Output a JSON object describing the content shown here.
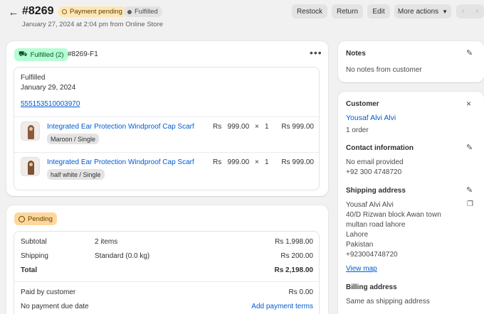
{
  "header": {
    "order_id": "#8269",
    "payment_status": "Payment pending",
    "fulfillment_status": "Fulfilled",
    "subtitle": "January 27, 2024 at 2:04 pm from Online Store",
    "buttons": {
      "restock": "Restock",
      "return": "Return",
      "edit": "Edit",
      "more": "More actions"
    }
  },
  "fulfillment": {
    "tag": "Fulfilled (2)",
    "number": "#8269-F1",
    "status_label": "Fulfilled",
    "date": "January 29, 2024",
    "tracking": "555153510003970",
    "items": [
      {
        "name": "Integrated Ear Protection Windproof Cap Scarf",
        "variant": "Maroon / Single",
        "price": "Rs   999.00",
        "times": "×",
        "qty": "1",
        "total": "Rs 999.00"
      },
      {
        "name": "Integrated Ear Protection Windproof Cap Scarf",
        "variant": "half white / Single",
        "price": "Rs   999.00",
        "times": "×",
        "qty": "1",
        "total": "Rs 999.00"
      }
    ]
  },
  "payment": {
    "tag": "Pending",
    "rows": {
      "subtotal": {
        "label": "Subtotal",
        "mid": "2 items",
        "value": "Rs 1,998.00"
      },
      "shipping": {
        "label": "Shipping",
        "mid": "Standard (0.0 kg)",
        "value": "Rs 200.00"
      },
      "total": {
        "label": "Total",
        "value": "Rs 2,198.00"
      },
      "paid": {
        "label": "Paid by customer",
        "value": "Rs 0.00"
      },
      "due": {
        "label": "No payment due date",
        "action": "Add payment terms"
      }
    }
  },
  "notes": {
    "title": "Notes",
    "text": "No notes from customer"
  },
  "customer": {
    "title": "Customer",
    "name": "Yousaf Alvi Alvi",
    "orders": "1 order",
    "contact_title": "Contact information",
    "email": "No email provided",
    "phone": "+92 300 4748720",
    "shipping_title": "Shipping address",
    "address_lines": [
      "Yousaf Alvi Alvi",
      "40/D Rizwan block Awan town",
      "multan road lahore",
      "Lahore",
      "Pakistan",
      "+923004748720"
    ],
    "view_map": "View map",
    "billing_title": "Billing address",
    "billing_text": "Same as shipping address"
  }
}
